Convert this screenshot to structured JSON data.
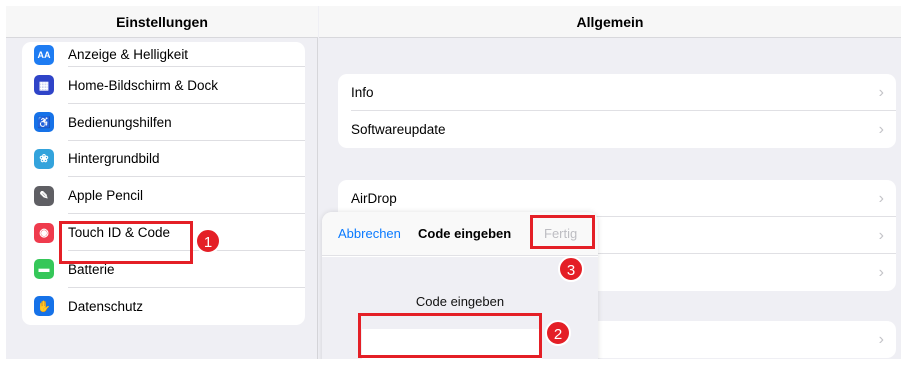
{
  "sidebar": {
    "title": "Einstellungen",
    "items": [
      {
        "label": "Anzeige & Helligkeit",
        "icon": "display-brightness-icon",
        "glyph": "AA",
        "color": "#1e7cf2"
      },
      {
        "label": "Home-Bildschirm & Dock",
        "icon": "home-screen-icon",
        "glyph": "▦",
        "color": "#2f44c8"
      },
      {
        "label": "Bedienungshilfen",
        "icon": "accessibility-icon",
        "glyph": "♿",
        "color": "#1672e8"
      },
      {
        "label": "Hintergrundbild",
        "icon": "wallpaper-icon",
        "glyph": "❀",
        "color": "#33a3dc"
      },
      {
        "label": "Apple Pencil",
        "icon": "pencil-icon",
        "glyph": "✎",
        "color": "#5f5f64"
      },
      {
        "label": "Touch ID & Code",
        "icon": "fingerprint-icon",
        "glyph": "◉",
        "color": "#ef3b4d"
      },
      {
        "label": "Batterie",
        "icon": "battery-icon",
        "glyph": "▬",
        "color": "#35c759"
      },
      {
        "label": "Datenschutz",
        "icon": "privacy-hand-icon",
        "glyph": "✋",
        "color": "#1672e8"
      }
    ]
  },
  "main": {
    "title": "Allgemein",
    "group1": [
      {
        "label": "Info"
      },
      {
        "label": "Softwareupdate"
      }
    ],
    "group2": [
      {
        "label": "AirDrop"
      }
    ]
  },
  "modal": {
    "cancel_label": "Abbrechen",
    "title": "Code eingeben",
    "done_label": "Fertig",
    "prompt": "Code eingeben",
    "code_value": ""
  },
  "annotations": {
    "badge1": "1",
    "badge2": "2",
    "badge3": "3",
    "color": "#e41f26"
  }
}
